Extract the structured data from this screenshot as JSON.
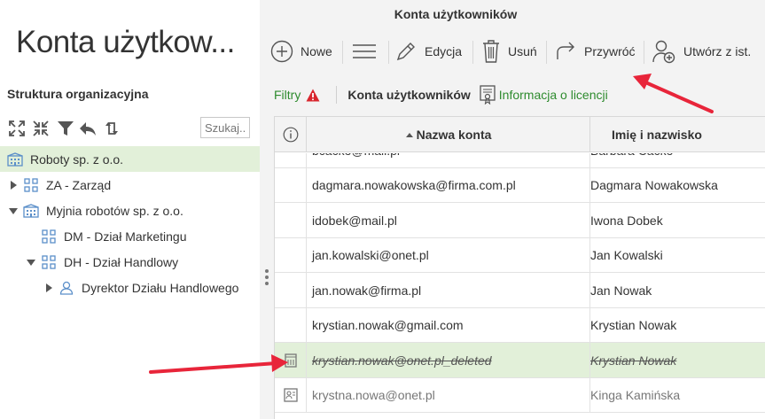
{
  "app": {
    "title": "Konta użytkow..."
  },
  "left": {
    "section_label": "Struktura organizacyjna",
    "search_placeholder": "Szukaj...",
    "tree": [
      {
        "label": "Roboty sp. z o.o.",
        "level": 0,
        "expander": "none",
        "icon": "building-icon",
        "selected": true
      },
      {
        "label": "ZA - Zarząd",
        "level": 0,
        "expander": "collapsed",
        "icon": "org-unit-icon",
        "selected": false
      },
      {
        "label": "Myjnia robotów sp. z o.o.",
        "level": 0,
        "expander": "expanded",
        "icon": "building-icon",
        "selected": false
      },
      {
        "label": "DM - Dział Marketingu",
        "level": 1,
        "expander": "none",
        "icon": "org-unit-icon",
        "selected": false
      },
      {
        "label": "DH - Dział Handlowy",
        "level": 1,
        "expander": "expanded",
        "icon": "org-unit-icon",
        "selected": false
      },
      {
        "label": "Dyrektor Działu Handlowego",
        "level": 2,
        "expander": "collapsed",
        "icon": "person-icon",
        "selected": false
      }
    ]
  },
  "window": {
    "title": "Konta użytkowników"
  },
  "toolbar": {
    "new_label": "Nowe",
    "edit_label": "Edycja",
    "delete_label": "Usuń",
    "restore_label": "Przywróć",
    "create_from_label": "Utwórz z ist."
  },
  "subbar": {
    "filters_label": "Filtry",
    "view_label": "Konta użytkowników",
    "license_label": "Informacja o licencji"
  },
  "grid": {
    "columns": {
      "account": "Nazwa konta",
      "name": "Imię i nazwisko"
    },
    "rows": [
      {
        "account": "bcacko@mail.pl",
        "name": "Barbara Cacko",
        "state": "normal"
      },
      {
        "account": "dagmara.nowakowska@firma.com.pl",
        "name": "Dagmara Nowakowska",
        "state": "normal"
      },
      {
        "account": "idobek@mail.pl",
        "name": "Iwona Dobek",
        "state": "normal"
      },
      {
        "account": "jan.kowalski@onet.pl",
        "name": "Jan Kowalski",
        "state": "normal"
      },
      {
        "account": "jan.nowak@firma.pl",
        "name": "Jan Nowak",
        "state": "normal"
      },
      {
        "account": "krystian.nowak@gmail.com",
        "name": "Krystian Nowak",
        "state": "normal"
      },
      {
        "account": "krystian.nowak@onet.pl_deleted",
        "name": "Krystian Nowak",
        "state": "deleted"
      },
      {
        "account": "krystna.nowa@onet.pl",
        "name": "Kinga Kamińska",
        "state": "gray"
      }
    ]
  },
  "colors": {
    "accent_green": "#2e8b2e",
    "selection_bg": "#e2f0d9",
    "tree_icon_blue": "#5b8fc9",
    "annotation_red": "#e8253a"
  }
}
